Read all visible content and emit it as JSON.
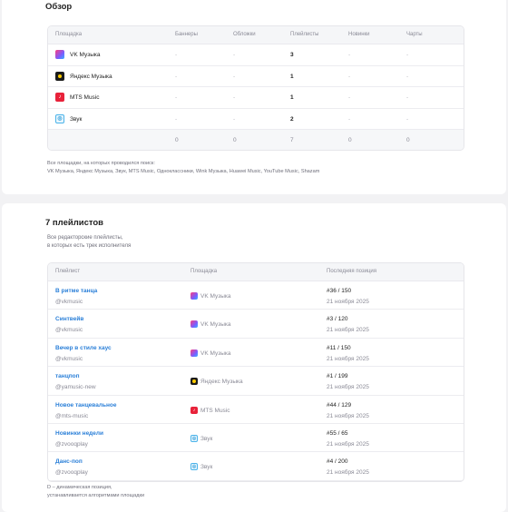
{
  "overview": {
    "title": "Обзор",
    "headers": [
      "Площадка",
      "Баннеры",
      "Обложки",
      "Плейлисты",
      "Новинки",
      "Чарты"
    ],
    "rows": [
      {
        "icon": "vk-music-icon",
        "name": "VK Музыка",
        "banners": "-",
        "covers": "-",
        "playlists": "3",
        "new": "-",
        "charts": "-"
      },
      {
        "icon": "yandex-music-icon",
        "name": "Яндекс Музыка",
        "banners": "-",
        "covers": "-",
        "playlists": "1",
        "new": "-",
        "charts": "-"
      },
      {
        "icon": "mts-music-icon",
        "name": "MTS Music",
        "banners": "-",
        "covers": "-",
        "playlists": "1",
        "new": "-",
        "charts": "-"
      },
      {
        "icon": "zvuk-icon",
        "name": "Звук",
        "banners": "-",
        "covers": "-",
        "playlists": "2",
        "new": "-",
        "charts": "-"
      }
    ],
    "totals": {
      "banners": "0",
      "covers": "0",
      "playlists": "7",
      "new": "0",
      "charts": "0"
    },
    "note_line1": "Все площадки, на которых проводился поиск:",
    "note_line2": "VK Музыка, Яндекс Музыка, Звук, MTS Music, Одноклассники, Wink Музыка, Huawei Music, YouTube Music, Shazam"
  },
  "playlists": {
    "title": "7 плейлистов",
    "subtitle_line1": "Все редакторские плейлисты,",
    "subtitle_line2": "в которых есть трек исполнителя",
    "headers": [
      "Плейлист",
      "Площадка",
      "Последняя позиция"
    ],
    "rows": [
      {
        "name": "В ритме танца",
        "handle": "@vkmusic",
        "icon": "vk-music-icon",
        "platform": "VK Музыка",
        "position": "#36 / 150",
        "date": "21 ноября 2025"
      },
      {
        "name": "Синтвейв",
        "handle": "@vkmusic",
        "icon": "vk-music-icon",
        "platform": "VK Музыка",
        "position": "#3 / 120",
        "date": "21 ноября 2025"
      },
      {
        "name": "Вечер в стиле хаус",
        "handle": "@vkmusic",
        "icon": "vk-music-icon",
        "platform": "VK Музыка",
        "position": "#11 / 150",
        "date": "21 ноября 2025"
      },
      {
        "name": "танцпоп",
        "handle": "@yamusic-new",
        "icon": "yandex-music-icon",
        "platform": "Яндекс Музыка",
        "position": "#1 / 199",
        "date": "21 ноября 2025"
      },
      {
        "name": "Новое танцевальное",
        "handle": "@mts-music",
        "icon": "mts-music-icon",
        "platform": "MTS Music",
        "position": "#44 / 129",
        "date": "21 ноября 2025"
      },
      {
        "name": "Новинки недели",
        "handle": "@zvooqplay",
        "icon": "zvuk-icon",
        "platform": "Звук",
        "position": "#55 / 65",
        "date": "21 ноября 2025"
      },
      {
        "name": "Данс-поп",
        "handle": "@zvooqplay",
        "icon": "zvuk-icon",
        "platform": "Звук",
        "position": "#4 / 200",
        "date": "21 ноября 2025"
      }
    ],
    "note_line1": "D – динамическая позиция,",
    "note_line2": "устанавливается алгоритмами площадки"
  }
}
